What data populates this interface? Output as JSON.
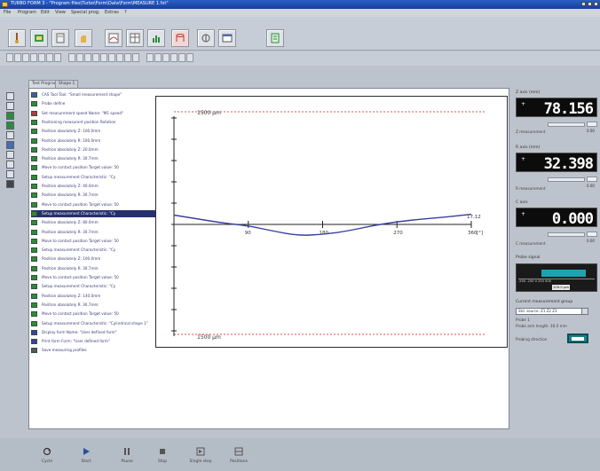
{
  "window": {
    "title": "TURBO FORM 3 - \"Program files\\Turbo\\Form\\Data\\Form\\MEASURE 1.fxt\""
  },
  "menu": [
    "File",
    "Program",
    "Edit",
    "View",
    "Special prog.",
    "Extras",
    "?"
  ],
  "tabs": [
    "Test Program",
    "Shape 1"
  ],
  "program_rows": [
    {
      "text": "CAS Tool Tool: \"Small measurement shape\"",
      "color": "#3f5fa8"
    },
    {
      "text": "Probe define",
      "color": "#2e8b3a"
    },
    {
      "text": "Set measurement speed Name: \"M1 speed\"",
      "color": "#b43b3b"
    },
    {
      "text": "Positioning measurent position Rotation",
      "color": "#2e8b3a"
    },
    {
      "text": "Position absolutely Z: 100.0mm",
      "color": "#2e8b3a"
    },
    {
      "text": "Position absolutely R: 100.0mm",
      "color": "#2e8b3a"
    },
    {
      "text": "Position absolutely Z: 20.0mm",
      "color": "#2e8b3a"
    },
    {
      "text": "Position absolutely R: 30.7mm",
      "color": "#2e8b3a"
    },
    {
      "text": "Move to contact position Target value: 50",
      "color": "#2e8b3a"
    },
    {
      "text": "Setup measurement Characteristic: \"Cy",
      "color": "#2e8b3a"
    },
    {
      "text": "Position absolutely Z: 40.0mm",
      "color": "#2e8b3a"
    },
    {
      "text": "Position absolutely R: 30.7mm",
      "color": "#2e8b3a"
    },
    {
      "text": "Move to contact position Target value: 50",
      "color": "#2e8b3a"
    },
    {
      "text": "Setup measurement Characteristic: \"Cy",
      "color": "#2e8b3a",
      "selected": true
    },
    {
      "text": "Position absolutely Z: 80.0mm",
      "color": "#2e8b3a"
    },
    {
      "text": "Position absolutely R: 30.7mm",
      "color": "#2e8b3a"
    },
    {
      "text": "Move to contact position Target value: 50",
      "color": "#2e8b3a"
    },
    {
      "text": "Setup measurement Characteristic: \"Cy",
      "color": "#2e8b3a"
    },
    {
      "text": "Position absolutely Z: 100.0mm",
      "color": "#2e8b3a"
    },
    {
      "text": "Position absolutely R: 30.7mm",
      "color": "#2e8b3a"
    },
    {
      "text": "Move to contact position Target value: 50",
      "color": "#2e8b3a"
    },
    {
      "text": "Setup measurement Characteristic: \"Cy",
      "color": "#2e8b3a"
    },
    {
      "text": "Position absolutely Z: 140.0mm",
      "color": "#2e8b3a"
    },
    {
      "text": "Position absolutely R: 30.7mm",
      "color": "#2e8b3a"
    },
    {
      "text": "Move to contact position Target value: 50",
      "color": "#2e8b3a"
    },
    {
      "text": "Setup measurement Characteristic: \"Cylindrical shape 1\"",
      "color": "#2e8b3a"
    },
    {
      "text": "Display form Name: \"User defined form\"",
      "color": "#3f3f9a"
    },
    {
      "text": "Print form Form: \"User defined form\"",
      "color": "#3f3f9a"
    },
    {
      "text": "Save measuring profiles",
      "color": "#555555"
    }
  ],
  "plot": {
    "upper_limit_label": "1500 µm",
    "lower_limit_label": "1500 µm",
    "x_ticks": [
      "90",
      "180",
      "270",
      "360"
    ],
    "x_unit": "[°]",
    "end_value_label": "17,12",
    "profile_points": [
      [
        0,
        0.35
      ],
      [
        30,
        0.2
      ],
      [
        60,
        0.05
      ],
      [
        90,
        -0.05
      ],
      [
        120,
        -0.25
      ],
      [
        150,
        -0.42
      ],
      [
        180,
        -0.38
      ],
      [
        210,
        -0.25
      ],
      [
        240,
        -0.05
      ],
      [
        270,
        0.1
      ],
      [
        300,
        0.2
      ],
      [
        330,
        0.28
      ],
      [
        360,
        0.38
      ]
    ]
  },
  "bottom_buttons": [
    "Cycle",
    "Start",
    "Pause",
    "Stop",
    "Single step",
    "Positions"
  ],
  "right_panel": {
    "group1": {
      "label": "Z axis (mm)",
      "sign": "+",
      "value": "78.156",
      "sublabel": "Z measurement",
      "spin_value": "0.00"
    },
    "group2": {
      "label": "R axis (mm)",
      "sign": "+",
      "value": "32.398",
      "sublabel": "R measurement",
      "spin_value": "0.00"
    },
    "group3": {
      "label": "C axis",
      "sign": "+",
      "value": "0.000",
      "sublabel": "C measurement",
      "spin_value": "0.00"
    },
    "probe": {
      "label": "Probe signal",
      "scale": "-500 -250 0 250 500",
      "current": "109.0 µm"
    },
    "select": {
      "label": "Current measurement group",
      "value": "Std. source: Z1 Z2 Z3",
      "line2": "Probe 1",
      "line3": "Probe arm length: 30.0 mm",
      "toggle_label": "Probing direction"
    }
  },
  "accent": "#2a5fc9"
}
